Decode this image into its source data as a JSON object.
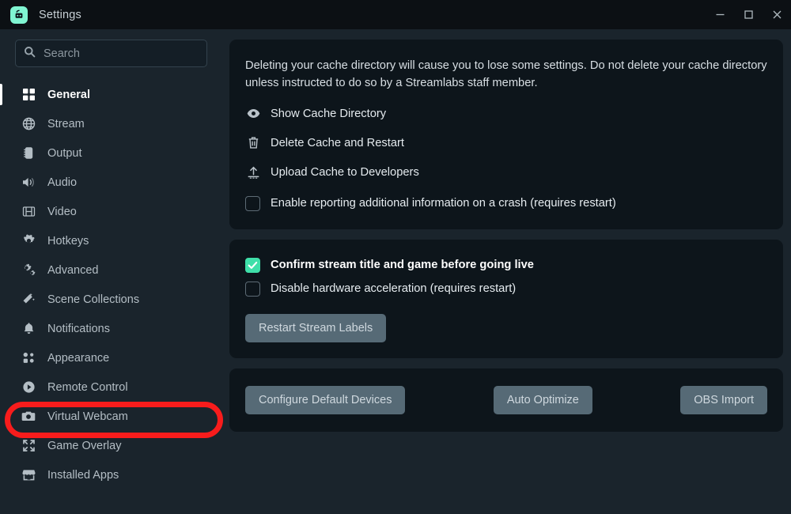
{
  "window": {
    "title": "Settings",
    "logo_icon": "streamlabs-logo-icon",
    "controls": {
      "minimize": "minimize-icon",
      "maximize": "maximize-icon",
      "close": "close-icon"
    }
  },
  "colors": {
    "page_bg": "#1a242c",
    "titlebar_bg": "#0c1014",
    "card_bg": "#0d151b",
    "accent": "#3fdfa9",
    "logo": "#80f5d2",
    "button": "#566a76",
    "annotation": "#f81c1c",
    "text": "#e6ecf0",
    "muted_text": "#b4bec5"
  },
  "sidebar": {
    "search": {
      "placeholder": "Search",
      "value": "",
      "icon": "search-icon"
    },
    "items": [
      {
        "label": "General",
        "icon": "grid-icon",
        "active": true
      },
      {
        "label": "Stream",
        "icon": "globe-icon",
        "active": false
      },
      {
        "label": "Output",
        "icon": "chip-icon",
        "active": false
      },
      {
        "label": "Audio",
        "icon": "speaker-icon",
        "active": false
      },
      {
        "label": "Video",
        "icon": "film-icon",
        "active": false
      },
      {
        "label": "Hotkeys",
        "icon": "gear-icon",
        "active": false
      },
      {
        "label": "Advanced",
        "icon": "gears-icon",
        "active": false
      },
      {
        "label": "Scene Collections",
        "icon": "wand-icon",
        "active": false
      },
      {
        "label": "Notifications",
        "icon": "bell-icon",
        "active": false
      },
      {
        "label": "Appearance",
        "icon": "dots-icon",
        "active": false
      },
      {
        "label": "Remote Control",
        "icon": "play-circle-icon",
        "active": false
      },
      {
        "label": "Virtual Webcam",
        "icon": "camera-icon",
        "active": false
      },
      {
        "label": "Game Overlay",
        "icon": "expand-icon",
        "active": false
      },
      {
        "label": "Installed Apps",
        "icon": "store-icon",
        "active": false
      }
    ]
  },
  "main": {
    "cache_card": {
      "paragraph": "Deleting your cache directory will cause you to lose some settings. Do not delete your cache directory unless instructed to do so by a Streamlabs staff member.",
      "actions": [
        {
          "label": "Show Cache Directory",
          "icon": "eye-icon"
        },
        {
          "label": "Delete Cache and Restart",
          "icon": "trash-icon"
        },
        {
          "label": "Upload Cache to Developers",
          "icon": "upload-icon"
        }
      ],
      "checkbox": {
        "label": "Enable reporting additional information on a crash (requires restart)",
        "checked": false
      }
    },
    "options_card": {
      "checkboxes": [
        {
          "label": "Confirm stream title and game before going live",
          "checked": true
        },
        {
          "label": "Disable hardware acceleration (requires restart)",
          "checked": false
        }
      ],
      "restart_button": "Restart Stream Labels"
    },
    "tools_card": {
      "buttons": [
        {
          "label": "Configure Default Devices"
        },
        {
          "label": "Auto Optimize"
        },
        {
          "label": "OBS Import"
        }
      ]
    }
  },
  "annotation": {
    "shape": "ellipse",
    "target": "Virtual Webcam",
    "color": "#f81c1c"
  }
}
